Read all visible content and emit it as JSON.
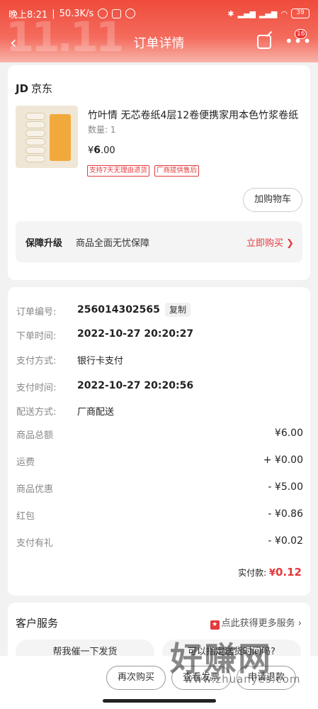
{
  "status_bar": {
    "time": "晚上8:21",
    "speed": "50.3K/s",
    "battery": "39"
  },
  "nav": {
    "title": "订单详情",
    "badge": "16"
  },
  "shop": {
    "logo": "JD",
    "name": "京东"
  },
  "product": {
    "name": "竹叶情 无芯卷纸4层12卷便携家用本色竹浆卷纸",
    "quantity": "数量: 1",
    "currency": "¥",
    "price_int": "6",
    "price_dec": ".00",
    "tags": [
      "支持7天无理由退货",
      "厂商提供售后"
    ],
    "add_cart": "加购物车"
  },
  "upgrade": {
    "key": "保障升级",
    "value": "商品全面无忧保障",
    "link": "立即购买 ❯"
  },
  "order": {
    "rows": [
      {
        "label": "订单编号:",
        "value": "256014302565"
      },
      {
        "label": "下单时间:",
        "value": "2022-10-27 20:20:27"
      },
      {
        "label": "支付方式:",
        "value": "银行卡支付"
      },
      {
        "label": "支付时间:",
        "value": "2022-10-27 20:20:56"
      },
      {
        "label": "配送方式:",
        "value": "厂商配送"
      }
    ],
    "copy": "复制",
    "amounts": [
      {
        "label": "商品总额",
        "value": "¥6.00"
      },
      {
        "label": "运费",
        "value": "+ ¥0.00"
      },
      {
        "label": "商品优惠",
        "value": "- ¥5.00"
      },
      {
        "label": "红包",
        "value": "- ¥0.86"
      },
      {
        "label": "支付有礼",
        "value": "- ¥0.02"
      }
    ],
    "paid_label": "实付款:",
    "paid_currency": "¥",
    "paid_value": "0.12"
  },
  "service": {
    "title": "客户服务",
    "link": "点此获得更多服务 ›",
    "buttons": [
      "帮我催一下发货",
      "可以指定送货时间吗?"
    ]
  },
  "bottom": {
    "buttons": [
      "再次购买",
      "查看发票",
      "申请退款"
    ]
  },
  "watermark": {
    "big": "好赚网",
    "small": "www.zhuanyes.com"
  },
  "colors": {
    "accent": "#e4393c",
    "header": "#ef4b3b"
  }
}
